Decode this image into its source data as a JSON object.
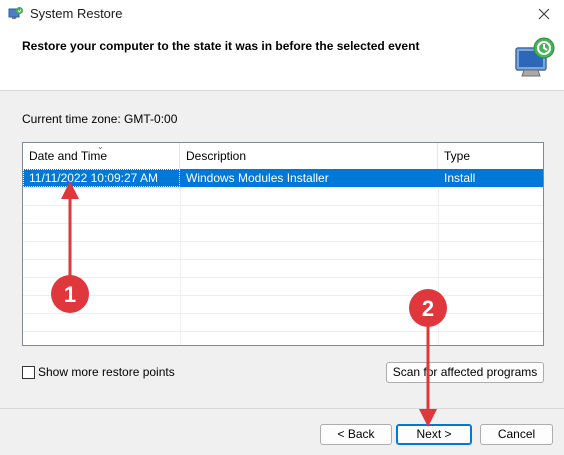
{
  "window": {
    "title": "System Restore"
  },
  "header": {
    "title": "Restore your computer to the state it was in before the selected event"
  },
  "timezone": {
    "label": "Current time zone: GMT-0:00"
  },
  "table": {
    "columns": [
      "Date and Time",
      "Description",
      "Type"
    ],
    "rows": [
      {
        "date": "11/11/2022 10:09:27 AM",
        "description": "Windows Modules Installer",
        "type": "Install",
        "selected": true
      }
    ]
  },
  "options": {
    "show_more_label": "Show more restore points",
    "show_more_checked": false
  },
  "buttons": {
    "scan": "Scan for affected programs",
    "back": "< Back",
    "next": "Next >",
    "cancel": "Cancel"
  },
  "annotations": {
    "marker1": "1",
    "marker2": "2"
  },
  "colors": {
    "selection": "#0078d7",
    "annotation": "#e0373c"
  },
  "icons": {
    "title": "system-restore-icon",
    "header": "restore-monitor-icon",
    "close": "close-icon"
  }
}
